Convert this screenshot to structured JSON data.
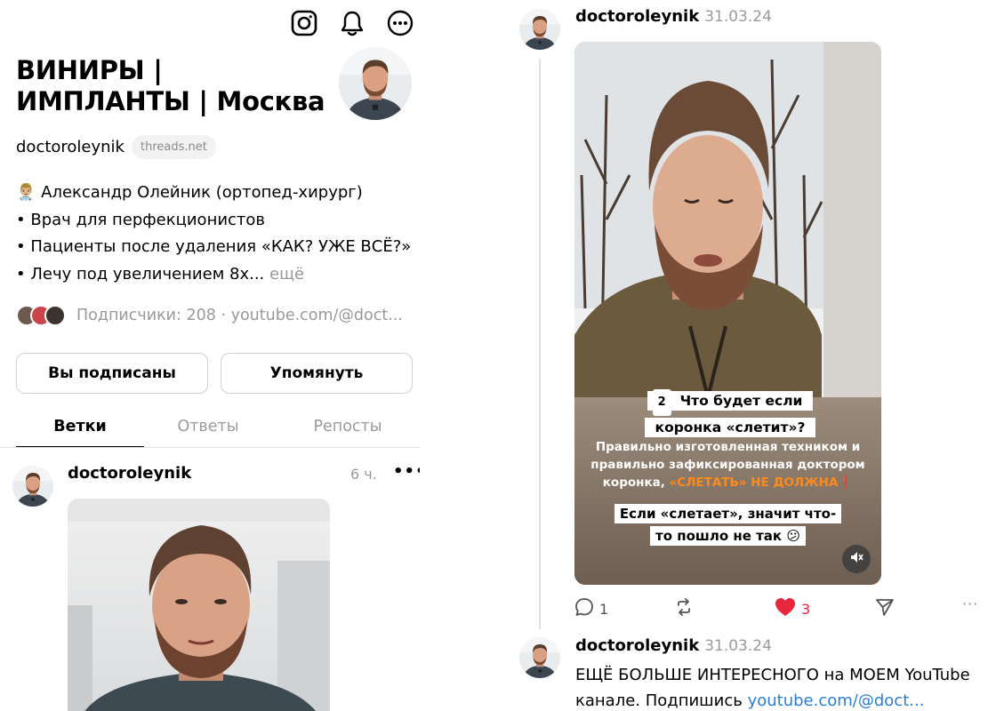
{
  "profile": {
    "name": "ВИНИРЫ |\nИМПЛАНТЫ | Москва",
    "handle": "doctoroleynik",
    "domain": "threads.net",
    "bio": {
      "line1": "👨🏼‍⚕️ Александр Олейник (ортопед-хирург)",
      "line2": "• Врач для перфекционистов",
      "line3": "• Пациенты после удаления «КАК? УЖЕ ВСЁ?»",
      "line4": "• Лечу под увеличением 8х...",
      "more": "ещё"
    },
    "followers_text": "Подписчики: 208 · youtube.com/@doct...",
    "buttons": {
      "subscribed": "Вы подписаны",
      "mention": "Упомянуть"
    },
    "tabs": [
      "Ветки",
      "Ответы",
      "Репосты"
    ],
    "active_tab": "Ветки"
  },
  "icons": {
    "instagram": "instagram-icon",
    "bell": "bell-icon",
    "more": "more-circle-icon"
  },
  "post_left": {
    "handle": "doctoroleynik",
    "time": "6 ч.",
    "more": "•••"
  },
  "post_right": {
    "handle": "doctoroleynik",
    "date": "31.03.24",
    "caption_number": "2",
    "caption_question": "Что будет если коронка «слетит»?",
    "caption_body_1": "Правильно изготовленная техником и правильно зафиксированная доктором коронка,",
    "caption_highlight": "«СЛЕТАТЬ» НЕ ДОЛЖНА",
    "caption_exclaim": "❗",
    "caption_if": "Если «слетает», значит что-то пошло не так 😕",
    "replies": "1",
    "likes": "3",
    "more": "···"
  },
  "post_third": {
    "handle": "doctoroleynik",
    "date": "31.03.24",
    "text": "ЕЩЁ БОЛЬШЕ ИНТЕРЕСНОГО на МОЕМ YouTube канале. Подпишись",
    "link": "youtube.com/@doct..."
  },
  "colors": {
    "like": "#e8273d",
    "link": "#2a7fd4",
    "muted": "#9a9a9a",
    "highlight": "#ff8a1c"
  }
}
